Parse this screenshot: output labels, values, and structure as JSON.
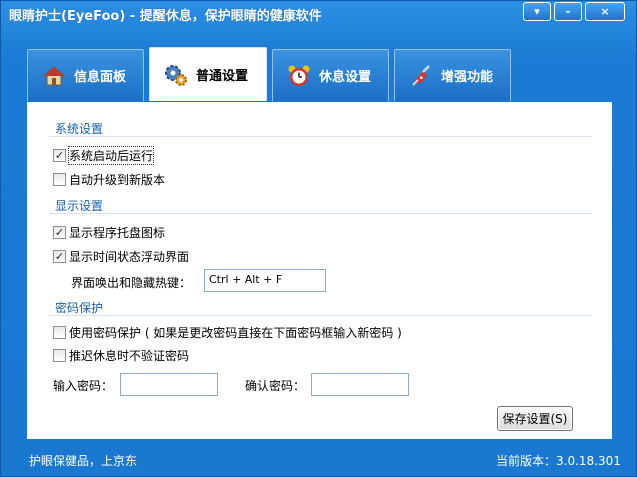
{
  "window": {
    "title": "眼睛护士(EyeFoo) - 提醒休息，保护眼睛的健康软件",
    "menu_glyph": "▾",
    "minimize_glyph": "–",
    "close_glyph": "×"
  },
  "tabs": [
    {
      "label": "信息面板",
      "icon": "house-icon",
      "active": false
    },
    {
      "label": "普通设置",
      "icon": "gears-icon",
      "active": true
    },
    {
      "label": "休息设置",
      "icon": "alarm-clock-icon",
      "active": false
    },
    {
      "label": "增强功能",
      "icon": "swiss-knife-icon",
      "active": false
    }
  ],
  "sections": {
    "system": {
      "title": "系统设置",
      "autostart": {
        "label": "系统启动后运行",
        "checked": true
      },
      "autoupdate": {
        "label": "自动升级到新版本",
        "checked": false
      }
    },
    "display": {
      "title": "显示设置",
      "tray_icon": {
        "label": "显示程序托盘图标",
        "checked": true
      },
      "float_ui": {
        "label": "显示时间状态浮动界面",
        "checked": true
      },
      "hotkey_label": "界面唤出和隐藏热键：",
      "hotkey_value": "Ctrl + Alt + F"
    },
    "password": {
      "title": "密码保护",
      "use_password": {
        "label": "使用密码保护 ( 如果是更改密码直接在下面密码框输入新密码 )",
        "checked": false
      },
      "postpone_no_verify": {
        "label": "推迟休息时不验证密码",
        "checked": false
      },
      "enter_label": "输入密码：",
      "confirm_label": "确认密码：",
      "enter_value": "",
      "confirm_value": ""
    }
  },
  "save_button": "保存设置(S)",
  "footer": {
    "left": "护眼保健品，上京东",
    "right": "当前版本：3.0.18.301"
  },
  "check_glyph": "✓"
}
